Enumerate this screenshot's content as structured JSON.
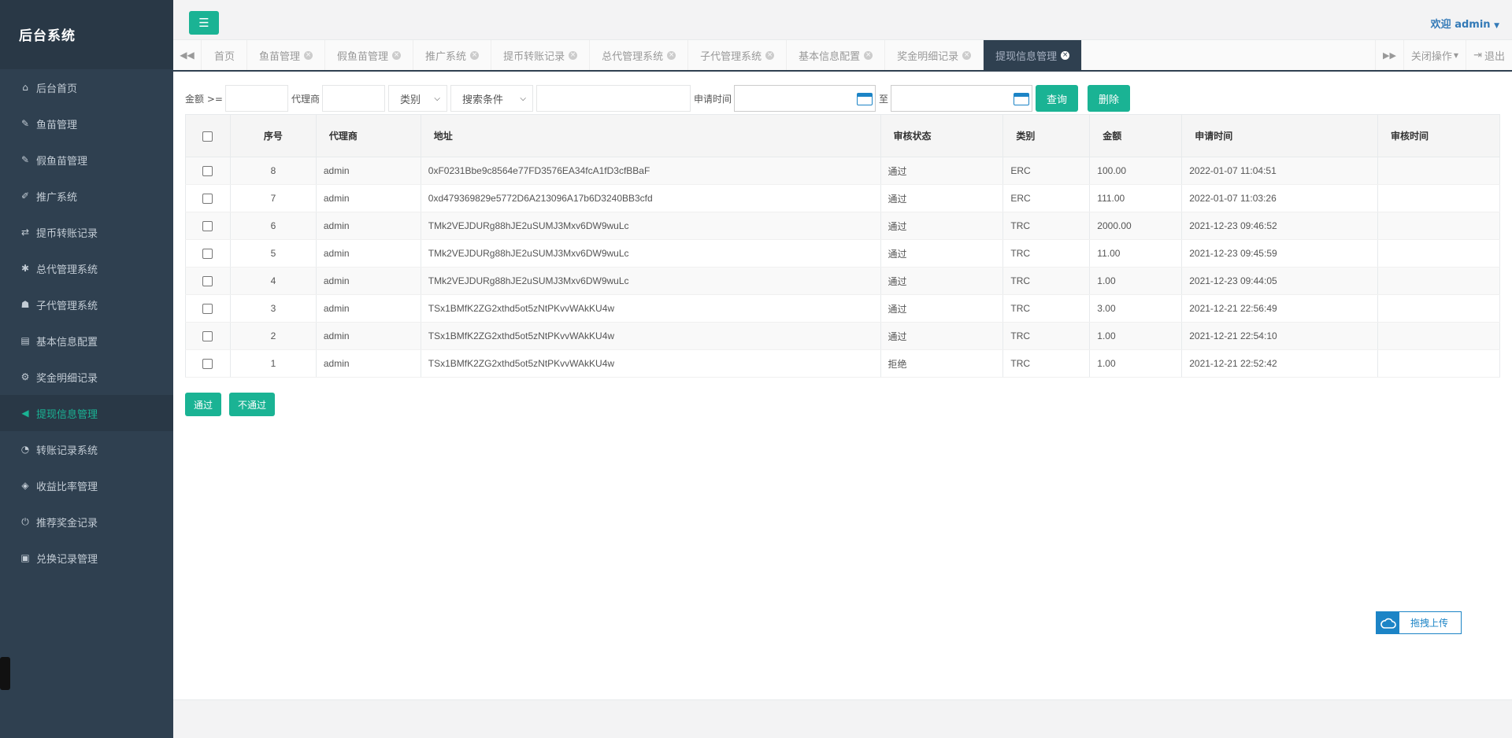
{
  "brand": "后台系统",
  "sidebar": {
    "items": [
      {
        "label": "后台首页",
        "icon": "home-icon",
        "glyph": "⌂"
      },
      {
        "label": "鱼苗管理",
        "icon": "wrench-icon",
        "glyph": "✎"
      },
      {
        "label": "假鱼苗管理",
        "icon": "wrench-icon",
        "glyph": "✎"
      },
      {
        "label": "推广系统",
        "icon": "edit-icon",
        "glyph": "✐"
      },
      {
        "label": "提币转账记录",
        "icon": "random-icon",
        "glyph": "⇄"
      },
      {
        "label": "总代管理系统",
        "icon": "asterisk-icon",
        "glyph": "✱"
      },
      {
        "label": "子代管理系统",
        "icon": "users-icon",
        "glyph": "☗"
      },
      {
        "label": "基本信息配置",
        "icon": "file-icon",
        "glyph": "▤"
      },
      {
        "label": "奖金明细记录",
        "icon": "cogs-icon",
        "glyph": "⚙"
      },
      {
        "label": "提现信息管理",
        "icon": "bullhorn-icon",
        "glyph": "◀",
        "active": true
      },
      {
        "label": "转账记录系统",
        "icon": "dashboard-icon",
        "glyph": "◔"
      },
      {
        "label": "收益比率管理",
        "icon": "shield-icon",
        "glyph": "◈"
      },
      {
        "label": "推荐奖金记录",
        "icon": "power-icon",
        "glyph": "⏻"
      },
      {
        "label": "兑换记录管理",
        "icon": "save-icon",
        "glyph": "▣"
      }
    ]
  },
  "header": {
    "welcome": "欢迎 admin"
  },
  "tabs": {
    "items": [
      {
        "label": "首页",
        "closable": false
      },
      {
        "label": "鱼苗管理",
        "closable": true
      },
      {
        "label": "假鱼苗管理",
        "closable": true
      },
      {
        "label": "推广系统",
        "closable": true
      },
      {
        "label": "提币转账记录",
        "closable": true
      },
      {
        "label": "总代管理系统",
        "closable": true
      },
      {
        "label": "子代管理系统",
        "closable": true
      },
      {
        "label": "基本信息配置",
        "closable": true
      },
      {
        "label": "奖金明细记录",
        "closable": true
      },
      {
        "label": "提现信息管理",
        "closable": true,
        "active": true
      }
    ],
    "close_ops": "关闭操作",
    "logout": "退出"
  },
  "filters": {
    "amount_label": "金额 >=",
    "agent_label": "代理商",
    "category_select": "类别",
    "search_select": "搜索条件",
    "apply_time_label": "申请时间",
    "to_label": "至",
    "query_button": "查询",
    "delete_button": "删除"
  },
  "table": {
    "columns": [
      "序号",
      "代理商",
      "地址",
      "审核状态",
      "类别",
      "金额",
      "申请时间",
      "审核时间"
    ],
    "rows": [
      {
        "id": "8",
        "agent": "admin",
        "address": "0xF0231Bbe9c8564e77FD3576EA34fcA1fD3cfBBaF",
        "status": "通过",
        "type": "ERC",
        "amount": "100.00",
        "apply_time": "2022-01-07 11:04:51",
        "review_time": ""
      },
      {
        "id": "7",
        "agent": "admin",
        "address": "0xd479369829e5772D6A213096A17b6D3240BB3cfd",
        "status": "通过",
        "type": "ERC",
        "amount": "111.00",
        "apply_time": "2022-01-07 11:03:26",
        "review_time": ""
      },
      {
        "id": "6",
        "agent": "admin",
        "address": "TMk2VEJDURg88hJE2uSUMJ3Mxv6DW9wuLc",
        "status": "通过",
        "type": "TRC",
        "amount": "2000.00",
        "apply_time": "2021-12-23 09:46:52",
        "review_time": ""
      },
      {
        "id": "5",
        "agent": "admin",
        "address": "TMk2VEJDURg88hJE2uSUMJ3Mxv6DW9wuLc",
        "status": "通过",
        "type": "TRC",
        "amount": "11.00",
        "apply_time": "2021-12-23 09:45:59",
        "review_time": ""
      },
      {
        "id": "4",
        "agent": "admin",
        "address": "TMk2VEJDURg88hJE2uSUMJ3Mxv6DW9wuLc",
        "status": "通过",
        "type": "TRC",
        "amount": "1.00",
        "apply_time": "2021-12-23 09:44:05",
        "review_time": ""
      },
      {
        "id": "3",
        "agent": "admin",
        "address": "TSx1BMfK2ZG2xthd5ot5zNtPKvvWAkKU4w",
        "status": "通过",
        "type": "TRC",
        "amount": "3.00",
        "apply_time": "2021-12-21 22:56:49",
        "review_time": ""
      },
      {
        "id": "2",
        "agent": "admin",
        "address": "TSx1BMfK2ZG2xthd5ot5zNtPKvvWAkKU4w",
        "status": "通过",
        "type": "TRC",
        "amount": "1.00",
        "apply_time": "2021-12-21 22:54:10",
        "review_time": ""
      },
      {
        "id": "1",
        "agent": "admin",
        "address": "TSx1BMfK2ZG2xthd5ot5zNtPKvvWAkKU4w",
        "status": "拒绝",
        "type": "TRC",
        "amount": "1.00",
        "apply_time": "2021-12-21 22:52:42",
        "review_time": ""
      }
    ]
  },
  "actions": {
    "approve": "通过",
    "reject": "不通过"
  },
  "upload": {
    "label": "拖拽上传"
  },
  "colors": {
    "sidebar_bg": "#2f4050",
    "accent": "#1ab394",
    "link": "#337ab7"
  }
}
